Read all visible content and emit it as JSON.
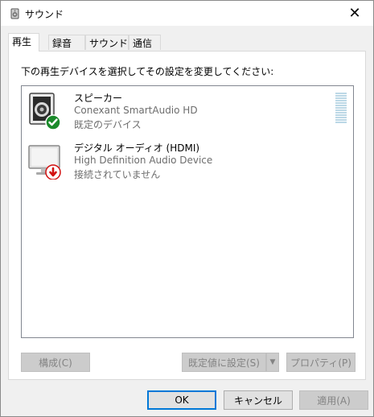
{
  "window": {
    "title": "サウンド",
    "close_glyph": "✕"
  },
  "tabs": [
    {
      "label": "再生",
      "active": true
    },
    {
      "label": "録音",
      "active": false
    },
    {
      "label": "サウンド",
      "active": false
    },
    {
      "label": "通信",
      "active": false
    }
  ],
  "instruction": "下の再生デバイスを選択してその設定を変更してください:",
  "devices": [
    {
      "name": "スピーカー",
      "description": "Conexant SmartAudio HD",
      "status": "既定のデバイス",
      "icon": "speaker-icon",
      "badge": "default-check-icon",
      "badge_color": "#1b8a2b"
    },
    {
      "name": "デジタル オーディオ (HDMI)",
      "description": "High Definition Audio Device",
      "status": "接続されていません",
      "icon": "monitor-icon",
      "badge": "disconnected-arrow-icon",
      "badge_color": "#d21010"
    }
  ],
  "buttons": {
    "configure": "構成(C)",
    "set_default": "既定値に設定(S)",
    "properties": "プロパティ(P)",
    "ok": "OK",
    "cancel": "キャンセル",
    "apply": "適用(A)"
  },
  "colors": {
    "accent": "#0078d7",
    "meter": "#bcd8e6"
  }
}
